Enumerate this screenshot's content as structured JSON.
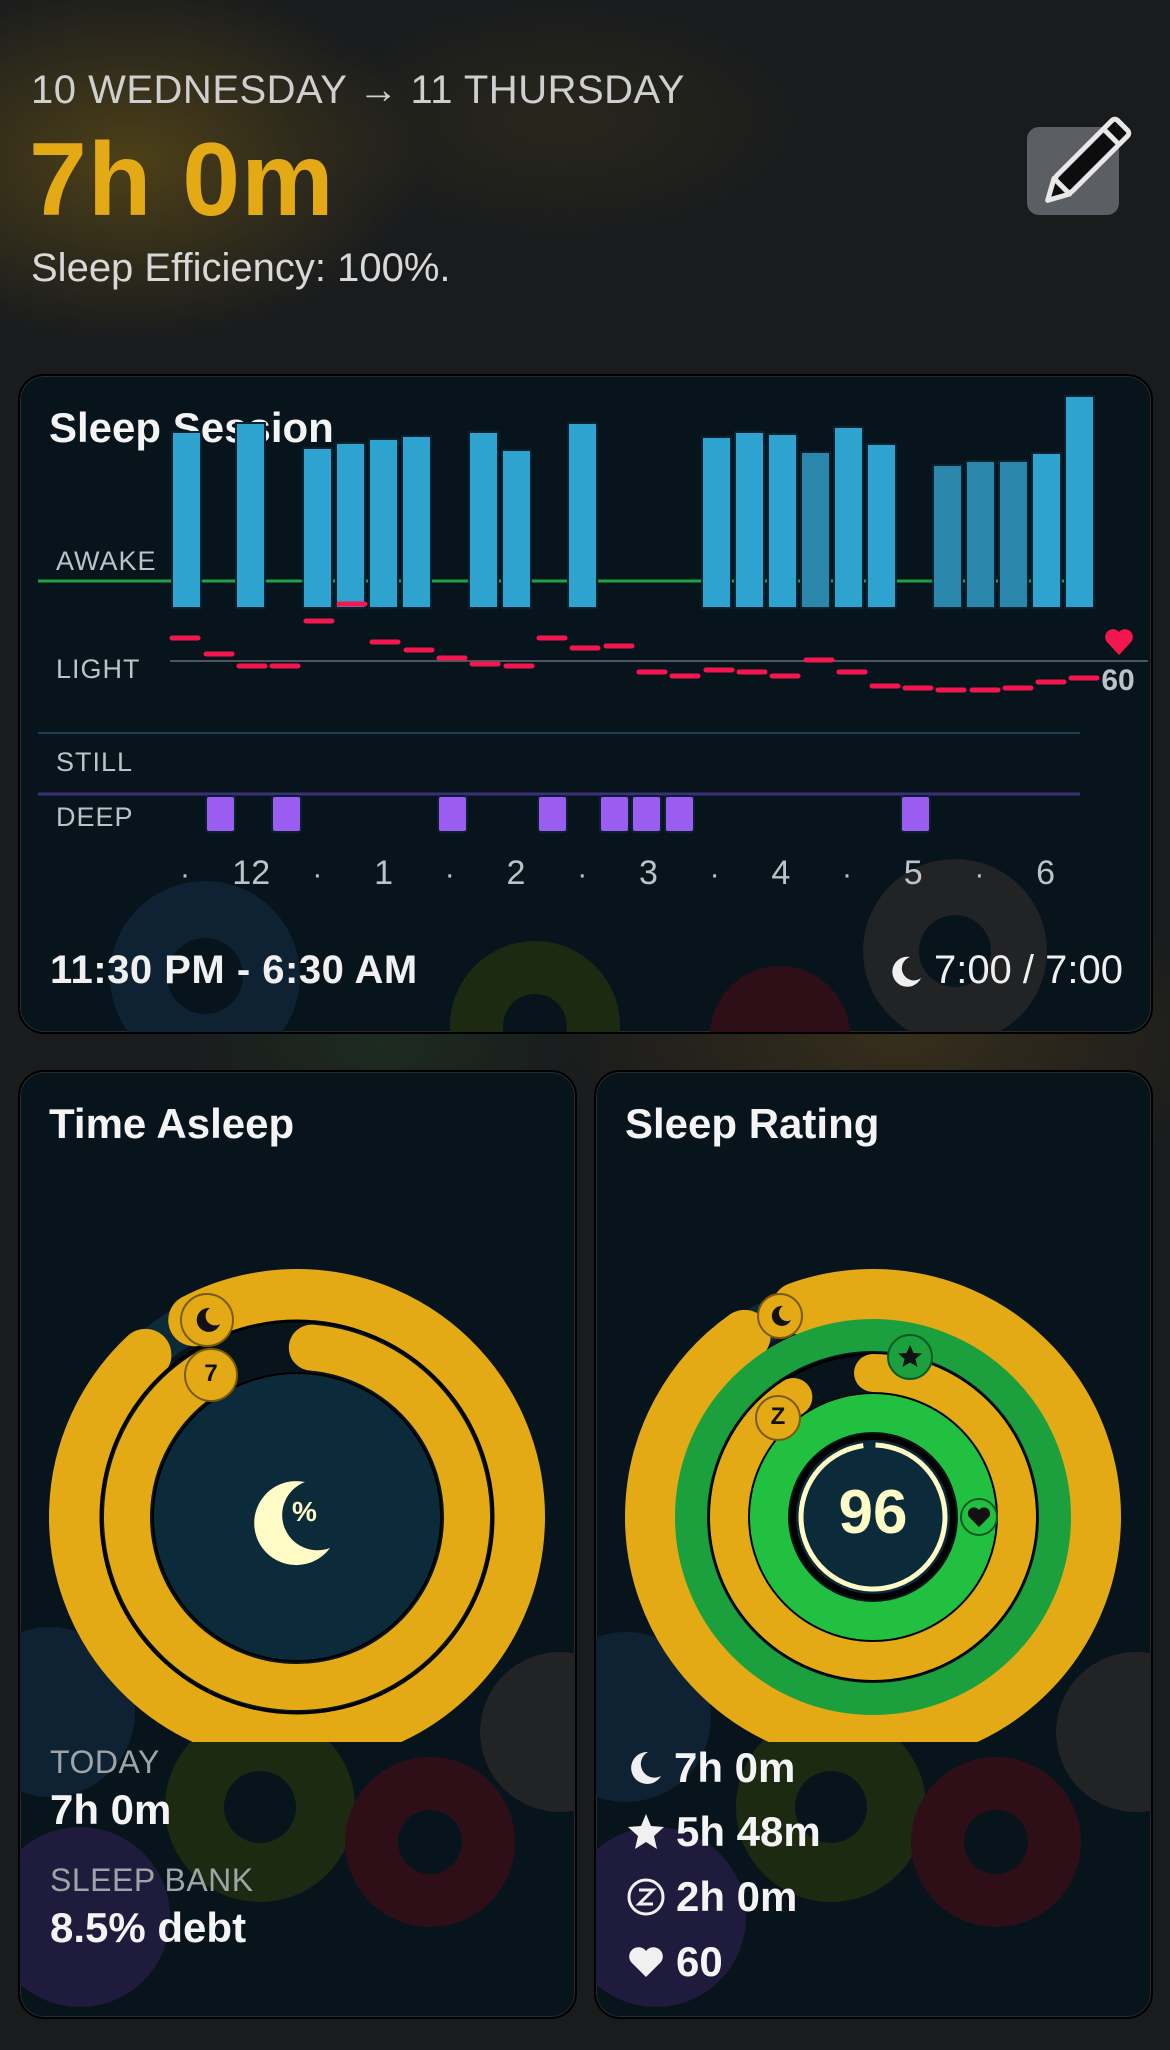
{
  "header": {
    "date_range": "10 WEDNESDAY → 11 THURSDAY",
    "duration": "7h 0m",
    "efficiency": "Sleep Efficiency: 100%."
  },
  "session": {
    "title": "Sleep Session",
    "stage_labels": [
      "AWAKE",
      "LIGHT",
      "STILL",
      "DEEP"
    ],
    "time_ticks": [
      "·",
      "12",
      "·",
      "1",
      "·",
      "2",
      "·",
      "3",
      "·",
      "4",
      "·",
      "5",
      "·",
      "6"
    ],
    "heart_rate_label": "60",
    "time_range": "11:30 PM - 6:30 AM",
    "goal": "7:00 / 7:00",
    "colors": {
      "light_bar": "#2fa3d0",
      "deep_bar": "#9b5cf2",
      "heart_rate": "#f4174f",
      "awake_line": "#1fa142"
    }
  },
  "time_asleep": {
    "title": "Time Asleep",
    "ring_badge": "7",
    "center_symbol": "%",
    "today_label": "TODAY",
    "today_value": "7h 0m",
    "bank_label": "SLEEP BANK",
    "bank_value": "8.5% debt"
  },
  "sleep_rating": {
    "title": "Sleep Rating",
    "score": "96",
    "z_badge": "Z",
    "rows": [
      {
        "icon": "moon-icon",
        "value": "7h 0m"
      },
      {
        "icon": "star-icon",
        "value": "5h 48m"
      },
      {
        "icon": "z-circle-icon",
        "value": "2h 0m"
      },
      {
        "icon": "heart-icon",
        "value": "60"
      }
    ]
  }
}
